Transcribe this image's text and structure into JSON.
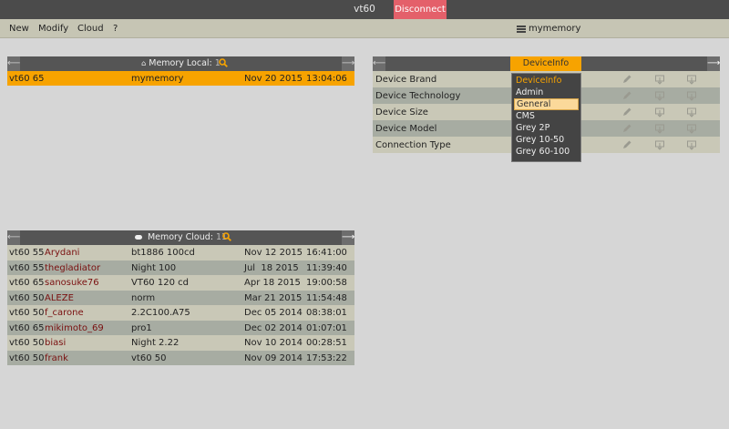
{
  "window": {
    "title": "vt60",
    "disconnect_label": "Disconnect"
  },
  "menu": {
    "items": [
      "New",
      "Modify",
      "Cloud",
      "?"
    ],
    "memory_name": "mymemory"
  },
  "local": {
    "title": "Memory Local:",
    "count": "1",
    "rows": [
      {
        "device": "vt60 65",
        "name": "mymemory",
        "date": "Nov 20 2015",
        "time": "13:04:06"
      }
    ]
  },
  "cloud": {
    "title": "Memory Cloud:",
    "count": "11",
    "rows": [
      {
        "device": "vt60 55",
        "user": "Arydani",
        "name": "bt1886 100cd",
        "date": "Nov 12 2015",
        "time": "16:41:00"
      },
      {
        "device": "vt60 55",
        "user": "thegladiator",
        "name": "Night 100",
        "date": "Jul  18 2015",
        "time": "11:39:40"
      },
      {
        "device": "vt60 65",
        "user": "sanosuke76",
        "name": "VT60 120 cd",
        "date": "Apr 18 2015",
        "time": "19:00:58"
      },
      {
        "device": "vt60 50",
        "user": "ALEZE",
        "name": "norm",
        "date": "Mar 21 2015",
        "time": "11:54:48"
      },
      {
        "device": "vt60 50",
        "user": "f_carone",
        "name": "2.2C100.A75",
        "date": "Dec 05 2014",
        "time": "08:38:01"
      },
      {
        "device": "vt60 65",
        "user": "mikimoto_69",
        "name": "pro1",
        "date": "Dec 02 2014",
        "time": "01:07:01"
      },
      {
        "device": "vt60 50",
        "user": "biasi",
        "name": "Night 2.22",
        "date": "Nov 10 2014",
        "time": "00:28:51"
      },
      {
        "device": "vt60 50",
        "user": "frank",
        "name": "vt60 50",
        "date": "Nov 09 2014",
        "time": "17:53:22"
      }
    ]
  },
  "device": {
    "tab_label": "DeviceInfo",
    "rows": [
      "Device Brand",
      "Device Technology",
      "Device Size",
      "Device Model",
      "Connection Type"
    ],
    "dropdown": {
      "options": [
        "DeviceInfo",
        "Admin",
        "General",
        "CMS",
        "Grey 2P",
        "Grey 10-50",
        "Grey 60-100"
      ],
      "selected": "DeviceInfo",
      "highlighted": "General"
    }
  },
  "colors": {
    "accent": "#f7a300",
    "disconnect": "#e4606a",
    "header": "#555555",
    "user_text": "#7a1010"
  }
}
